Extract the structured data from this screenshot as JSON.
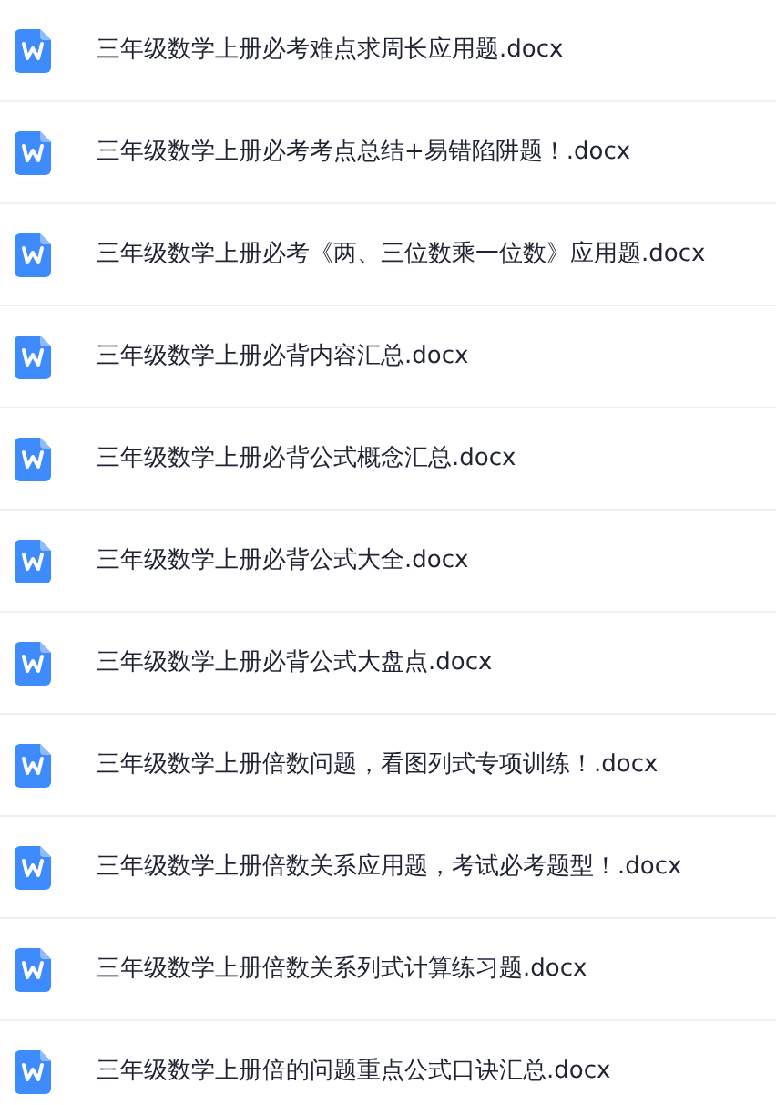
{
  "files": [
    {
      "name": "三年级数学上册必考难点求周长应用题.docx"
    },
    {
      "name": "三年级数学上册必考考点总结+易错陷阱题！.docx"
    },
    {
      "name": "三年级数学上册必考《两、三位数乘一位数》应用题.docx"
    },
    {
      "name": "三年级数学上册必背内容汇总.docx"
    },
    {
      "name": "三年级数学上册必背公式概念汇总.docx"
    },
    {
      "name": "三年级数学上册必背公式大全.docx"
    },
    {
      "name": "三年级数学上册必背公式大盘点.docx"
    },
    {
      "name": "三年级数学上册倍数问题，看图列式专项训练！.docx"
    },
    {
      "name": "三年级数学上册倍数关系应用题，考试必考题型！.docx"
    },
    {
      "name": "三年级数学上册倍数关系列式计算练习题.docx"
    },
    {
      "name": "三年级数学上册倍的问题重点公式口诀汇总.docx"
    }
  ]
}
